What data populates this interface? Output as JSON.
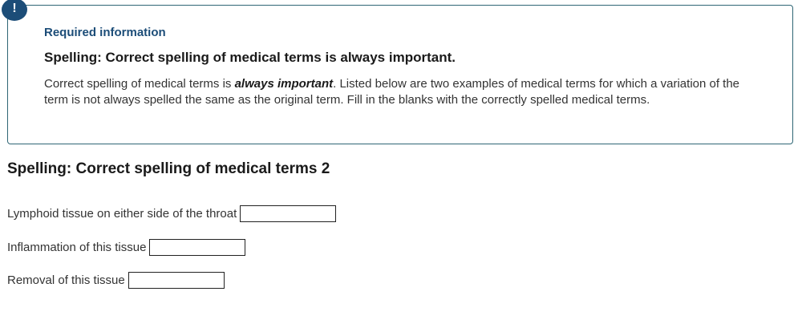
{
  "info_box": {
    "badge_icon": "!",
    "required_label": "Required information",
    "title": "Spelling: Correct spelling of medical terms is always important.",
    "body_prefix": "Correct spelling of medical terms is ",
    "body_emphasis": "always important",
    "body_suffix": ". Listed below are two examples of medical terms for which a variation of the term is not always spelled the same as the original term. Fill in the blanks with the correctly spelled medical terms."
  },
  "question": {
    "title": "Spelling: Correct spelling of medical terms 2",
    "items": [
      {
        "label": "Lymphoid tissue on either side of the throat",
        "value": ""
      },
      {
        "label": "Inflammation of this tissue",
        "value": ""
      },
      {
        "label": "Removal of this tissue",
        "value": ""
      }
    ]
  },
  "colors": {
    "accent": "#1c4d78",
    "box_border": "#2f6675",
    "text": "#333333"
  }
}
